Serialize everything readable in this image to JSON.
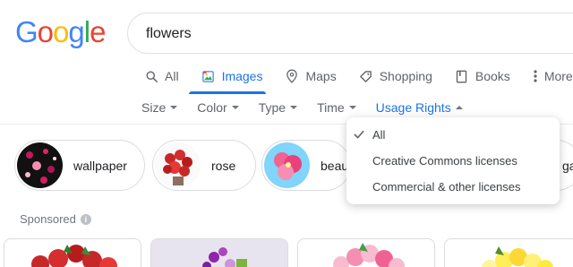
{
  "logo": {
    "letters": [
      "G",
      "o",
      "o",
      "g",
      "l",
      "e"
    ],
    "colors": [
      "#4285f4",
      "#ea4335",
      "#fbbc05",
      "#4285f4",
      "#34a853",
      "#ea4335"
    ]
  },
  "search": {
    "query": "flowers"
  },
  "tabs": [
    {
      "label": "All",
      "icon": "search-icon"
    },
    {
      "label": "Images",
      "icon": "image-icon",
      "active": true
    },
    {
      "label": "Maps",
      "icon": "map-pin-icon"
    },
    {
      "label": "Shopping",
      "icon": "tag-icon"
    },
    {
      "label": "Books",
      "icon": "book-icon"
    },
    {
      "label": "More",
      "icon": "more-vert-icon"
    }
  ],
  "filters": [
    {
      "label": "Size"
    },
    {
      "label": "Color"
    },
    {
      "label": "Type"
    },
    {
      "label": "Time"
    },
    {
      "label": "Usage Rights",
      "open": true
    }
  ],
  "chips": [
    {
      "label": "wallpaper"
    },
    {
      "label": "rose"
    },
    {
      "label": "beau"
    },
    {
      "label": "ga"
    }
  ],
  "sponsored": {
    "label": "Sponsored"
  },
  "usage_rights_menu": {
    "items": [
      {
        "label": "All",
        "checked": true
      },
      {
        "label": "Creative Commons licenses",
        "checked": false
      },
      {
        "label": "Commercial & other licenses",
        "checked": false
      }
    ]
  },
  "colors": {
    "accent": "#1a73e8",
    "muted": "#5f6368"
  }
}
